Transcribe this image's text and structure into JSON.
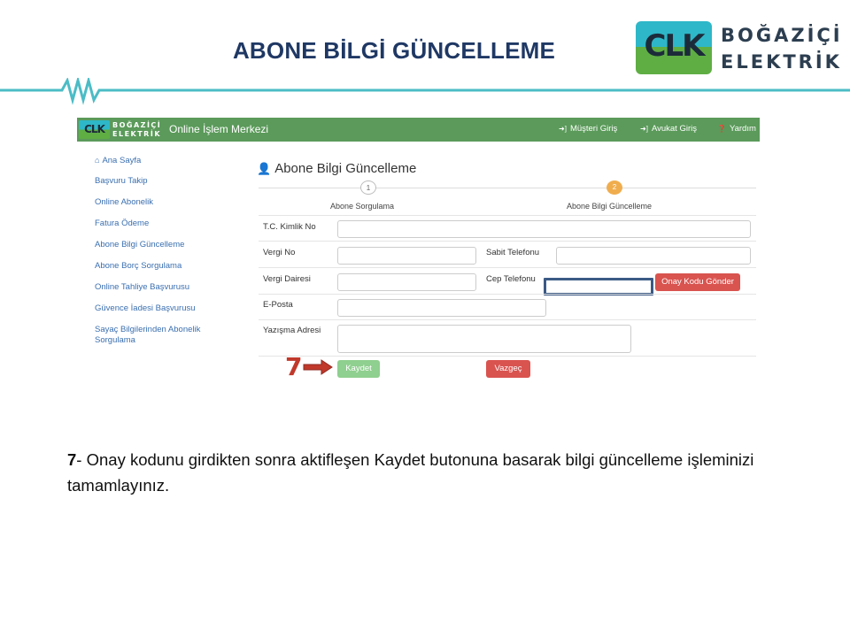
{
  "slide": {
    "title": "ABONE BİLGİ GÜNCELLEME",
    "logo": {
      "badge": "CLK",
      "line1": "BOĞAZİÇİ",
      "line2": "ELEKTRİK"
    },
    "colors": {
      "title": "#1f3864",
      "accent_line": "#4bbcc6",
      "callout": "#c0392b"
    }
  },
  "screenshot": {
    "topbar": {
      "logo_badge": "CLK",
      "logo_line1": "BOĞAZİÇİ",
      "logo_line2": "ELEKTRİK",
      "title": "Online İşlem Merkezi",
      "links": [
        {
          "icon": "sign-in-icon",
          "label": "Müşteri Giriş"
        },
        {
          "icon": "sign-in-icon",
          "label": "Avukat Giriş"
        },
        {
          "icon": "question-circle-icon",
          "label": "Yardım"
        }
      ],
      "color": "#5b9a5a"
    },
    "sidebar": [
      {
        "icon": "home-icon",
        "label": "Ana Sayfa"
      },
      {
        "label": "Başvuru Takip"
      },
      {
        "label": "Online Abonelik"
      },
      {
        "label": "Fatura Ödeme"
      },
      {
        "label": "Abone Bilgi Güncelleme"
      },
      {
        "label": "Abone Borç Sorgulama"
      },
      {
        "label": "Online Tahliye Başvurusu"
      },
      {
        "label": "Güvence İadesi Başvurusu"
      },
      {
        "label": "Sayaç Bilgilerinden Abonelik Sorgulama"
      }
    ],
    "form": {
      "title": "Abone Bilgi Güncelleme",
      "title_icon": "user-icon",
      "steps": [
        {
          "number": "1",
          "label": "Abone Sorgulama"
        },
        {
          "number": "2",
          "label": "Abone Bilgi Güncelleme",
          "active": true
        }
      ],
      "fields": {
        "tc_kimlik": {
          "label": "T.C. Kimlik No",
          "value": ""
        },
        "vergi_no": {
          "label": "Vergi No",
          "value": ""
        },
        "sabit_telefon": {
          "label": "Sabit Telefonu",
          "value": ""
        },
        "vergi_dairesi": {
          "label": "Vergi Dairesi",
          "value": ""
        },
        "cep_telefon": {
          "label": "Cep Telefonu",
          "value": ""
        },
        "eposta": {
          "label": "E-Posta",
          "value": ""
        },
        "yazisma_adresi": {
          "label": "Yazışma Adresi",
          "value": ""
        }
      },
      "buttons": {
        "onay_kodu": "Onay Kodu Gönder",
        "kaydet": "Kaydet",
        "vazgec": "Vazgeç"
      }
    }
  },
  "callout": {
    "number": "7"
  },
  "instruction": {
    "step": "7",
    "text": "- Onay kodunu girdikten sonra aktifleşen Kaydet butonuna basarak bilgi güncelleme işleminizi tamamlayınız."
  }
}
